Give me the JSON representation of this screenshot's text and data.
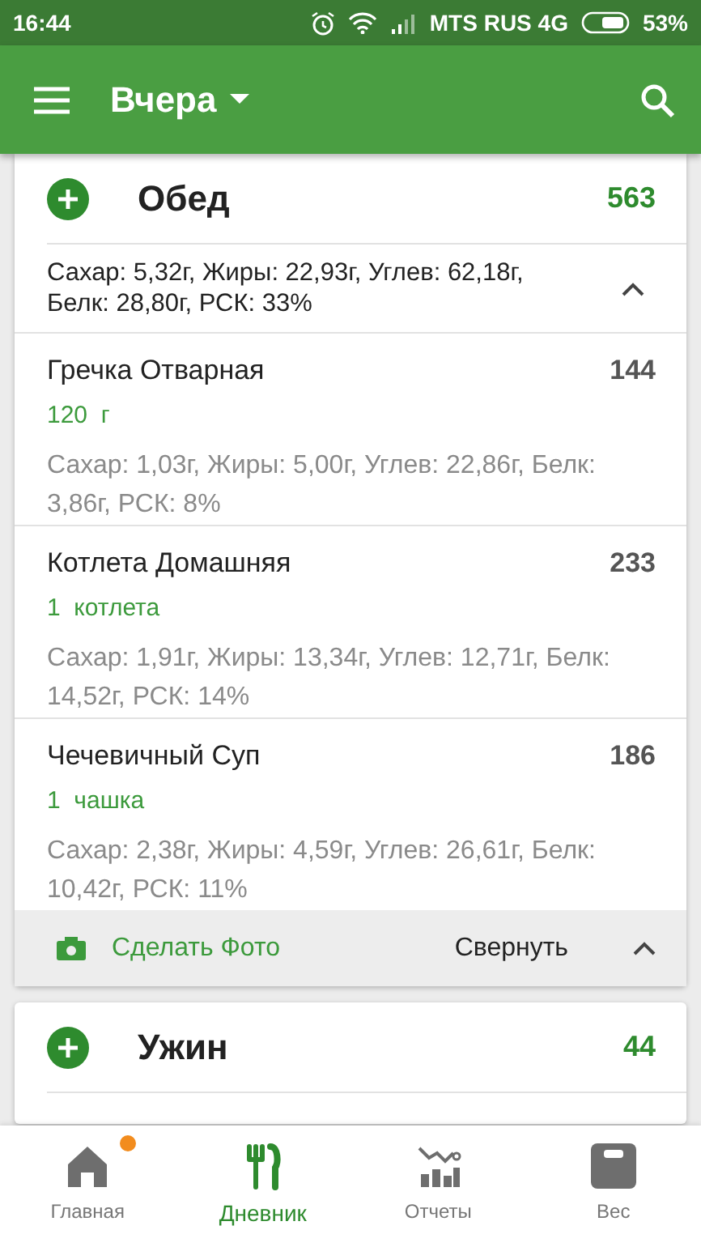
{
  "status_bar": {
    "time": "16:44",
    "carrier": "MTS RUS 4G",
    "battery": "53%"
  },
  "app_bar": {
    "title": "Вчера"
  },
  "meals": [
    {
      "name": "Обед",
      "calories": "563",
      "expanded": true,
      "summary": "Сахар: 5,32г, Жиры: 22,93г, Углев: 62,18г, Белк: 28,80г, РСК: 33%",
      "items": [
        {
          "name": "Гречка Отварная",
          "calories": "144",
          "portion": "120  г",
          "nutrients": "Сахар: 1,03г, Жиры: 5,00г, Углев: 22,86г, Белк: 3,86г, РСК: 8%"
        },
        {
          "name": "Котлета Домашняя",
          "calories": "233",
          "portion": "1  котлета",
          "nutrients": "Сахар: 1,91г, Жиры: 13,34г, Углев: 12,71г, Белк: 14,52г, РСК: 14%"
        },
        {
          "name": "Чечевичный Суп",
          "calories": "186",
          "portion": "1  чашка",
          "nutrients": "Сахар: 2,38г, Жиры: 4,59г, Углев: 26,61г, Белк: 10,42г, РСК: 11%"
        }
      ],
      "footer": {
        "photo": "Сделать Фото",
        "collapse": "Свернуть"
      }
    },
    {
      "name": "Ужин",
      "calories": "44",
      "expanded": false
    }
  ],
  "bottom_nav": [
    {
      "kind": "home",
      "label": "Главная",
      "selected": false,
      "badge": true
    },
    {
      "kind": "diary",
      "label": "Дневник",
      "selected": true,
      "badge": false
    },
    {
      "kind": "reports",
      "label": "Отчеты",
      "selected": false,
      "badge": false
    },
    {
      "kind": "weight",
      "label": "Вес",
      "selected": false,
      "badge": false
    }
  ]
}
